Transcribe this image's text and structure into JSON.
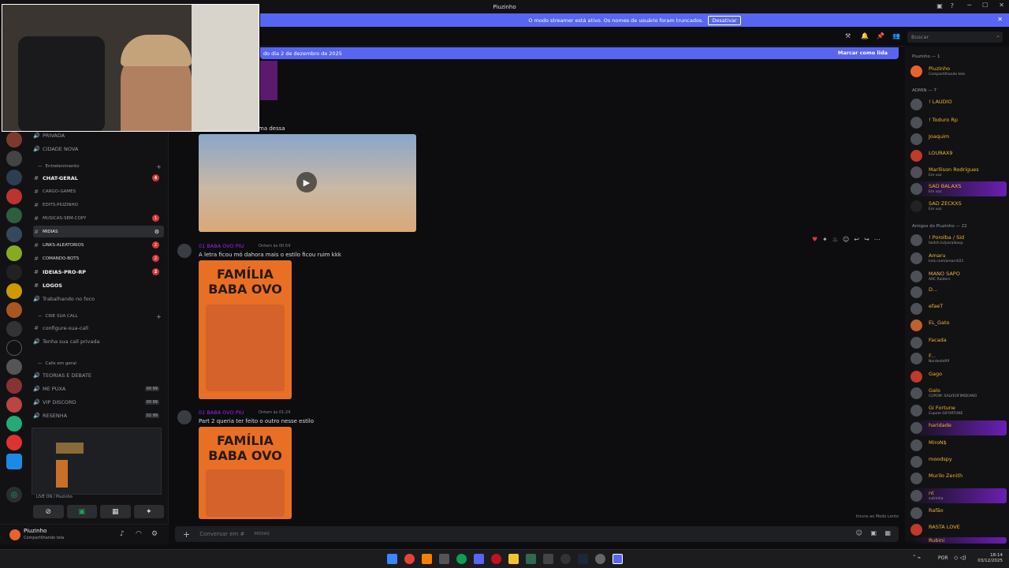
{
  "window": {
    "title": "Piuzinho"
  },
  "streamer_banner": {
    "text": "O modo streamer está ativo. Os nomes de usuário foram truncados.",
    "button": "Desativar"
  },
  "header": {
    "search_placeholder": "Buscar"
  },
  "new_messages_bar": {
    "text": "do dia 2 de dezembro de 2025",
    "mark_read": "Marcar como lida"
  },
  "channels": {
    "top_items": [
      {
        "label": "PRIVADA",
        "type": "voice"
      },
      {
        "label": "CIDADE NOVA",
        "type": "voice"
      }
    ],
    "category_entretenimento": "Entretenimento",
    "entretenimento_items": [
      {
        "label": "CHAT-GERAL",
        "badge": "4",
        "bold": true
      },
      {
        "label": "CARGO-GAMES",
        "badge": "",
        "bold": false
      },
      {
        "label": "EDITS-PIUZINHO",
        "badge": "",
        "bold": false
      },
      {
        "label": "MUSICAS-SEM-COPY",
        "badge": "1",
        "bold": false
      },
      {
        "label": "MIDIAS",
        "badge": "",
        "bold": false
      },
      {
        "label": "LINKS-ALEATORIOS",
        "badge": "2",
        "bold": false
      },
      {
        "label": "COMANDO-BOTS",
        "badge": "2",
        "bold": false
      },
      {
        "label": "IDEIAS-PRO-RP",
        "badge": "2",
        "bold": true
      },
      {
        "label": "LOGOS",
        "badge": "",
        "bold": true
      }
    ],
    "trabalhando": "Trabalhando no foco",
    "category_crie": "CRIE SUA CALL",
    "crie_items": [
      {
        "label": "configure-sua-call"
      },
      {
        "label": "Tenha sua call privada"
      }
    ],
    "category_calls": "Calls em geral",
    "calls_items": [
      {
        "label": "TEORIAS E DEBATE",
        "count": ""
      },
      {
        "label": "ME PUXA",
        "count": "00  99"
      },
      {
        "label": "VIP DISCORD",
        "count": "00  99"
      },
      {
        "label": "RESENHA",
        "count": "02  99"
      }
    ],
    "live_text": "LIVE ON / Piuzinho"
  },
  "user_panel": {
    "name": "Piuzinho",
    "status": "Compartilhando tela"
  },
  "messages": [
    {
      "text_fragment": "ma dessa"
    },
    {
      "author": "01 BABA OVO PIU",
      "time": "Ontem às 00:54",
      "text": "A letra ficou mó dahora mais o estilo ficou ruim kkk",
      "poster_title_1": "FAMÍLIA",
      "poster_title_2": "BABA OVO"
    },
    {
      "author": "01 BABA OVO PIU",
      "time": "Ontem às 01:24",
      "text": "Part 2 queria ter feito o outro nesse estilo",
      "poster_title_1": "FAMÍLIA",
      "poster_title_2": "BABA OVO"
    }
  ],
  "slowmode_text": "Imune ao Modo Lento",
  "composer": {
    "placeholder": "Conversar em #",
    "channel": "MIDIAS"
  },
  "members": {
    "group1": "Piuzinho — 1",
    "group1_items": [
      {
        "name": "Piuzinho",
        "status": "Compartilhando tela"
      }
    ],
    "group2": "ADMIN — 7",
    "group2_items": [
      {
        "name": "! LAUDIO",
        "status": ""
      },
      {
        "name": "! Toduro Rp",
        "status": ""
      },
      {
        "name": "Joaquim",
        "status": ""
      },
      {
        "name": "LOURAX9",
        "status": ""
      },
      {
        "name": "Marllison Rodrigues",
        "status": "Em voz"
      },
      {
        "name": "SAD BALAXS",
        "status": "Em voz"
      },
      {
        "name": "SAD ZECKXS",
        "status": "Em voz"
      }
    ],
    "group3": "Amigos do Piuzinho — 22",
    "group3_items": [
      {
        "name": "! Porolba / Sid",
        "status": "twitch.tv/paraibaxp"
      },
      {
        "name": "Amaru",
        "status": "kick.com/arears021"
      },
      {
        "name": "MANO SAPO",
        "status": "ARC Raiders"
      },
      {
        "name": "D...",
        "status": ""
      },
      {
        "name": "efaeT",
        "status": ""
      },
      {
        "name": "EL_Gato",
        "status": ""
      },
      {
        "name": "Facada",
        "status": ""
      },
      {
        "name": "F...",
        "status": "NordesteRP"
      },
      {
        "name": "Gago",
        "status": ""
      },
      {
        "name": "Galo",
        "status": "CUPOM: SALVEOFIMDEANO"
      },
      {
        "name": "Gi Fortune",
        "status": "Cupom GIFORTUNE"
      },
      {
        "name": "haridade",
        "status": ""
      },
      {
        "name": "MiroN$",
        "status": ""
      },
      {
        "name": "moodspy",
        "status": ""
      },
      {
        "name": "Murilo Zenith",
        "status": ""
      },
      {
        "name": "nt",
        "status": "sutrinha"
      },
      {
        "name": "Rafão",
        "status": ""
      },
      {
        "name": "RASTA LOVE",
        "status": ""
      },
      {
        "name": "Rubini",
        "status": ""
      }
    ]
  },
  "taskbar": {
    "lang": "POR",
    "time": "18:14",
    "date": "03/12/2025"
  },
  "colors": {
    "accent": "#5865f2",
    "badge": "#da373c",
    "member_name": "#f0b232",
    "author": "#a020f0",
    "poster": "#e86f24"
  }
}
